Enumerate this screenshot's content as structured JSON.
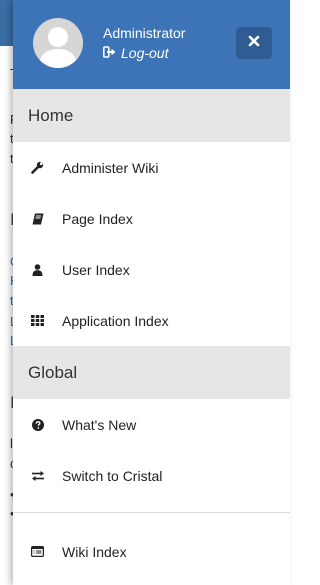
{
  "background_page": {
    "fragments": [
      "T",
      "F",
      "t",
      "t",
      "I",
      "C",
      "H",
      "t",
      "L",
      "L",
      "I",
      "l",
      "c",
      "•",
      "•"
    ]
  },
  "drawer": {
    "user": {
      "name": "Administrator",
      "logout_label": "Log-out"
    },
    "sections": {
      "home": {
        "title": "Home",
        "items": [
          {
            "label": "Administer Wiki",
            "icon": "wrench-icon"
          },
          {
            "label": "Page Index",
            "icon": "book-icon"
          },
          {
            "label": "User Index",
            "icon": "user-icon"
          },
          {
            "label": "Application Index",
            "icon": "grid-icon"
          }
        ]
      },
      "global": {
        "title": "Global",
        "items": [
          {
            "label": "What's New",
            "icon": "question-circle-icon"
          },
          {
            "label": "Switch to Cristal",
            "icon": "exchange-icon"
          }
        ]
      },
      "extra": {
        "items": [
          {
            "label": "Wiki Index",
            "icon": "list-alt-icon"
          }
        ]
      }
    },
    "colors": {
      "header_bg": "#3d74b8",
      "close_bg": "#2f5c93",
      "section_bg": "#e6e6e6"
    }
  }
}
